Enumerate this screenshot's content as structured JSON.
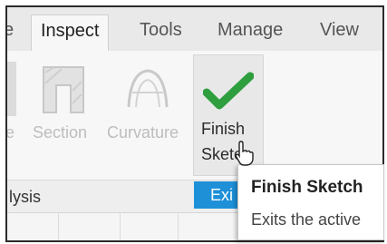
{
  "tabs": [
    {
      "label": "e"
    },
    {
      "label": "Inspect"
    },
    {
      "label": "Tools"
    },
    {
      "label": "Manage"
    },
    {
      "label": "View"
    }
  ],
  "ribbon": {
    "tools": [
      {
        "label": "e"
      },
      {
        "label": "Section"
      },
      {
        "label": "Curvature"
      }
    ],
    "finish": {
      "line1": "Finish",
      "line2": "Sketc"
    }
  },
  "group": {
    "label": "lysis",
    "exit_chip": "Exi"
  },
  "tooltip": {
    "title": "Finish Sketch",
    "description": "Exits the active"
  },
  "colors": {
    "accent": "#1e90d8",
    "check": "#2e9e3e"
  }
}
